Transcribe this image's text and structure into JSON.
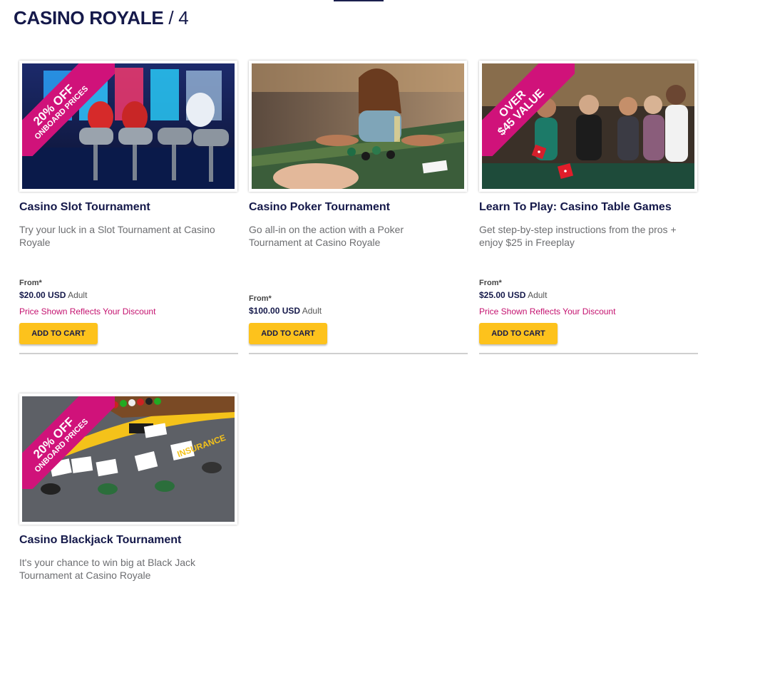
{
  "header": {
    "title": "CASINO ROYALE",
    "separator": "/",
    "count": "4"
  },
  "products": [
    {
      "title": "Casino Slot Tournament",
      "description": "Try your luck in a Slot Tournament at Casino Royale",
      "ribbon": {
        "line1": "20% OFF",
        "line2": "ONBOARD PRICES"
      },
      "from_label": "From*",
      "price": "$20.00",
      "currency": "USD",
      "unit": "Adult",
      "discount_note": "Price Shown Reflects Your Discount",
      "button": "ADD TO CART"
    },
    {
      "title": "Casino Poker Tournament",
      "description": "Go all-in on the action with a Poker Tournament at Casino Royale",
      "from_label": "From*",
      "price": "$100.00",
      "currency": "USD",
      "unit": "Adult",
      "button": "ADD TO CART"
    },
    {
      "title": "Learn To Play: Casino Table Games",
      "description": "Get step-by-step instructions from the pros + enjoy $25 in Freeplay",
      "ribbon": {
        "line1": "OVER",
        "line2": "$45 VALUE"
      },
      "from_label": "From*",
      "price": "$25.00",
      "currency": "USD",
      "unit": "Adult",
      "discount_note": "Price Shown Reflects Your Discount",
      "button": "ADD TO CART"
    },
    {
      "title": "Casino Blackjack Tournament",
      "description": "It's your chance to win big at Black Jack Tournament at Casino Royale",
      "ribbon": {
        "line1": "20% OFF",
        "line2": "ONBOARD PRICES"
      },
      "table_text": "INSURANCE"
    }
  ],
  "colors": {
    "navy": "#15194a",
    "ribbon": "#d0127a",
    "button": "#fdc21c",
    "discount": "#c4126f"
  }
}
